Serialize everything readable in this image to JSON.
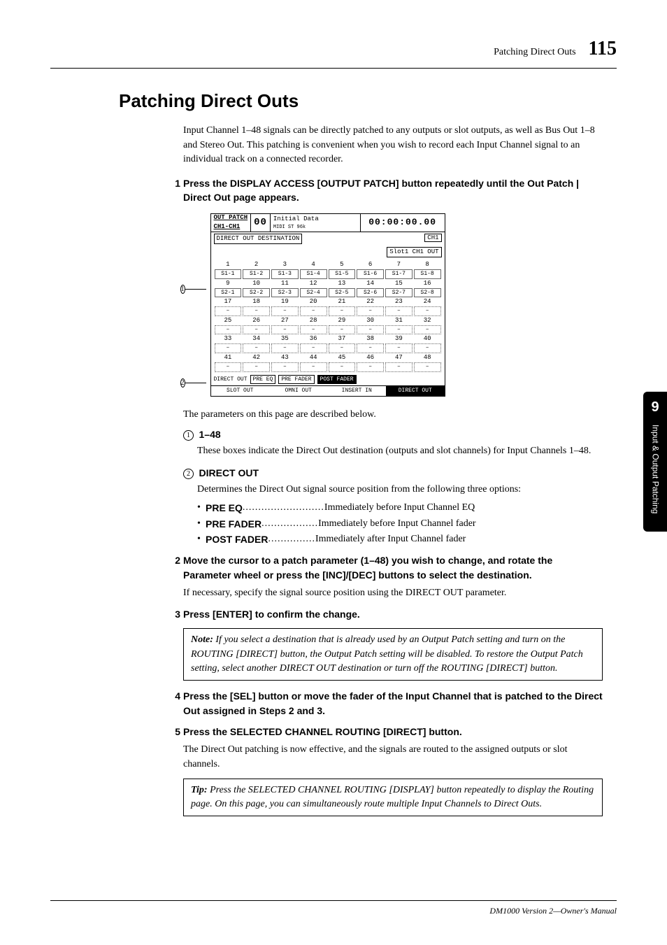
{
  "header": {
    "title": "Patching Direct Outs",
    "page": "115"
  },
  "section_title": "Patching Direct Outs",
  "intro": "Input Channel 1–48 signals can be directly patched to any outputs or slot outputs, as well as Bus Out 1–8 and Stereo Out. This patching is convenient when you wish to record each Input Channel signal to an individual track on a connected recorder.",
  "step1": {
    "num": "1",
    "text": "Press the DISPLAY ACCESS [OUTPUT PATCH] button repeatedly until the Out Patch | Direct Out page appears."
  },
  "lcd": {
    "topleft1": "OUT PATCH",
    "topleft2": "CH1-CH1",
    "big": "00",
    "mid": "Initial Data",
    "badges": "MIDI ST 96k",
    "tc": "00:00:00.00",
    "subtitle": "DIRECT OUT DESTINATION",
    "box1": "CH1",
    "box2": "Slot1 CH1 OUT",
    "cols": [
      "1",
      "2",
      "3",
      "4",
      "5",
      "6",
      "7",
      "8"
    ],
    "row1": [
      "S1-1",
      "S1-2",
      "S1-3",
      "S1-4",
      "S1-5",
      "S1-6",
      "S1-7",
      "S1-8"
    ],
    "cols2": [
      "9",
      "10",
      "11",
      "12",
      "13",
      "14",
      "15",
      "16"
    ],
    "row2": [
      "S2-1",
      "S2-2",
      "S2-3",
      "S2-4",
      "S2-5",
      "S2-6",
      "S2-7",
      "S2-8"
    ],
    "cols3": [
      "17",
      "18",
      "19",
      "20",
      "21",
      "22",
      "23",
      "24"
    ],
    "cols4": [
      "25",
      "26",
      "27",
      "28",
      "29",
      "30",
      "31",
      "32"
    ],
    "cols5": [
      "33",
      "34",
      "35",
      "36",
      "37",
      "38",
      "39",
      "40"
    ],
    "cols6": [
      "41",
      "42",
      "43",
      "44",
      "45",
      "46",
      "47",
      "48"
    ],
    "dash": "–",
    "dout_label": "DIRECT OUT",
    "btn_pre_eq": "PRE EQ",
    "btn_pre_fader": "PRE FADER",
    "btn_post_fader": "POST FADER",
    "tab1": "SLOT OUT",
    "tab2": "OMNI OUT",
    "tab3": "INSERT IN",
    "tab4": "DIRECT OUT"
  },
  "callouts": {
    "c1": "1",
    "c2": "2"
  },
  "params_intro": "The parameters on this page are described below.",
  "param1": {
    "circ": "1",
    "title": "1–48",
    "desc": "These boxes indicate the Direct Out destination (outputs and slot channels) for Input Channels 1–48."
  },
  "param2": {
    "circ": "2",
    "title": "DIRECT OUT",
    "desc": "Determines the Direct Out signal source position from the following three options:",
    "opts": [
      {
        "term": "PRE EQ",
        "dots": "..........................",
        "def": "Immediately before Input Channel EQ"
      },
      {
        "term": "PRE FADER",
        "dots": "..................",
        "def": "Immediately before Input Channel fader"
      },
      {
        "term": "POST FADER",
        "dots": "...............",
        "def": "Immediately after Input Channel fader"
      }
    ]
  },
  "step2": {
    "num": "2",
    "text": "Move the cursor to a patch parameter (1–48) you wish to change, and rotate the Parameter wheel or press the [INC]/[DEC] buttons to select the destination.",
    "body": "If necessary, specify the signal source position using the DIRECT OUT parameter."
  },
  "step3": {
    "num": "3",
    "text": "Press [ENTER] to confirm the change."
  },
  "note": {
    "label": "Note:",
    "body": "If you select a destination that is already used by an Output Patch setting and turn on the ROUTING [DIRECT] button, the Output Patch setting will be disabled. To restore the Output Patch setting, select another DIRECT OUT destination or turn off the ROUTING [DIRECT] button."
  },
  "step4": {
    "num": "4",
    "text": "Press the [SEL] button or move the fader of the Input Channel that is patched to the Direct Out assigned in Steps 2 and 3."
  },
  "step5": {
    "num": "5",
    "text": "Press the SELECTED CHANNEL ROUTING [DIRECT] button.",
    "body": "The Direct Out patching is now effective, and the signals are routed to the assigned outputs or slot channels."
  },
  "tip": {
    "label": "Tip:",
    "body": "Press the SELECTED CHANNEL ROUTING [DISPLAY] button repeatedly to display the Routing page. On this page, you can simultaneously route multiple Input Channels to Direct Outs."
  },
  "sidetab": {
    "num": "9",
    "label": "Input & Output Patching"
  },
  "footer": "DM1000 Version 2—Owner's Manual"
}
